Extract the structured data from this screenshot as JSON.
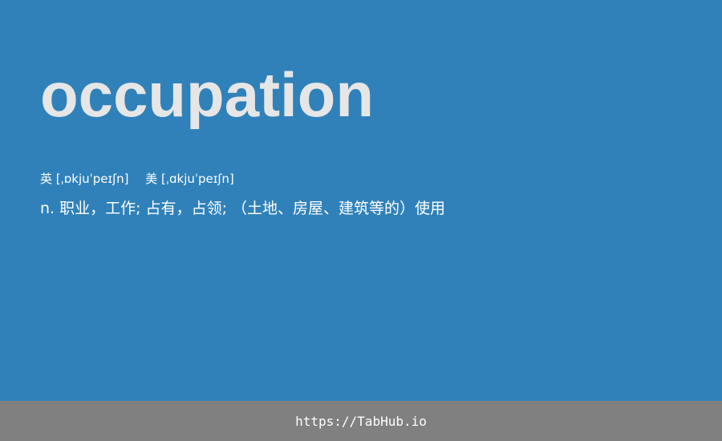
{
  "main": {
    "word": "occupation",
    "phonetics": {
      "uk": "英 [ˌɒkjuˈpeɪʃn]",
      "us": "美 [ˌɑkjuˈpeɪʃn]"
    },
    "definition": "n. 职业，工作; 占有，占领; （土地、房屋、建筑等的）使用"
  },
  "footer": {
    "url": "https://TabHub.io"
  },
  "colors": {
    "background": "#3081b9",
    "word": "#e6e6e6",
    "text": "#ffffff",
    "footer_background": "#808080"
  }
}
